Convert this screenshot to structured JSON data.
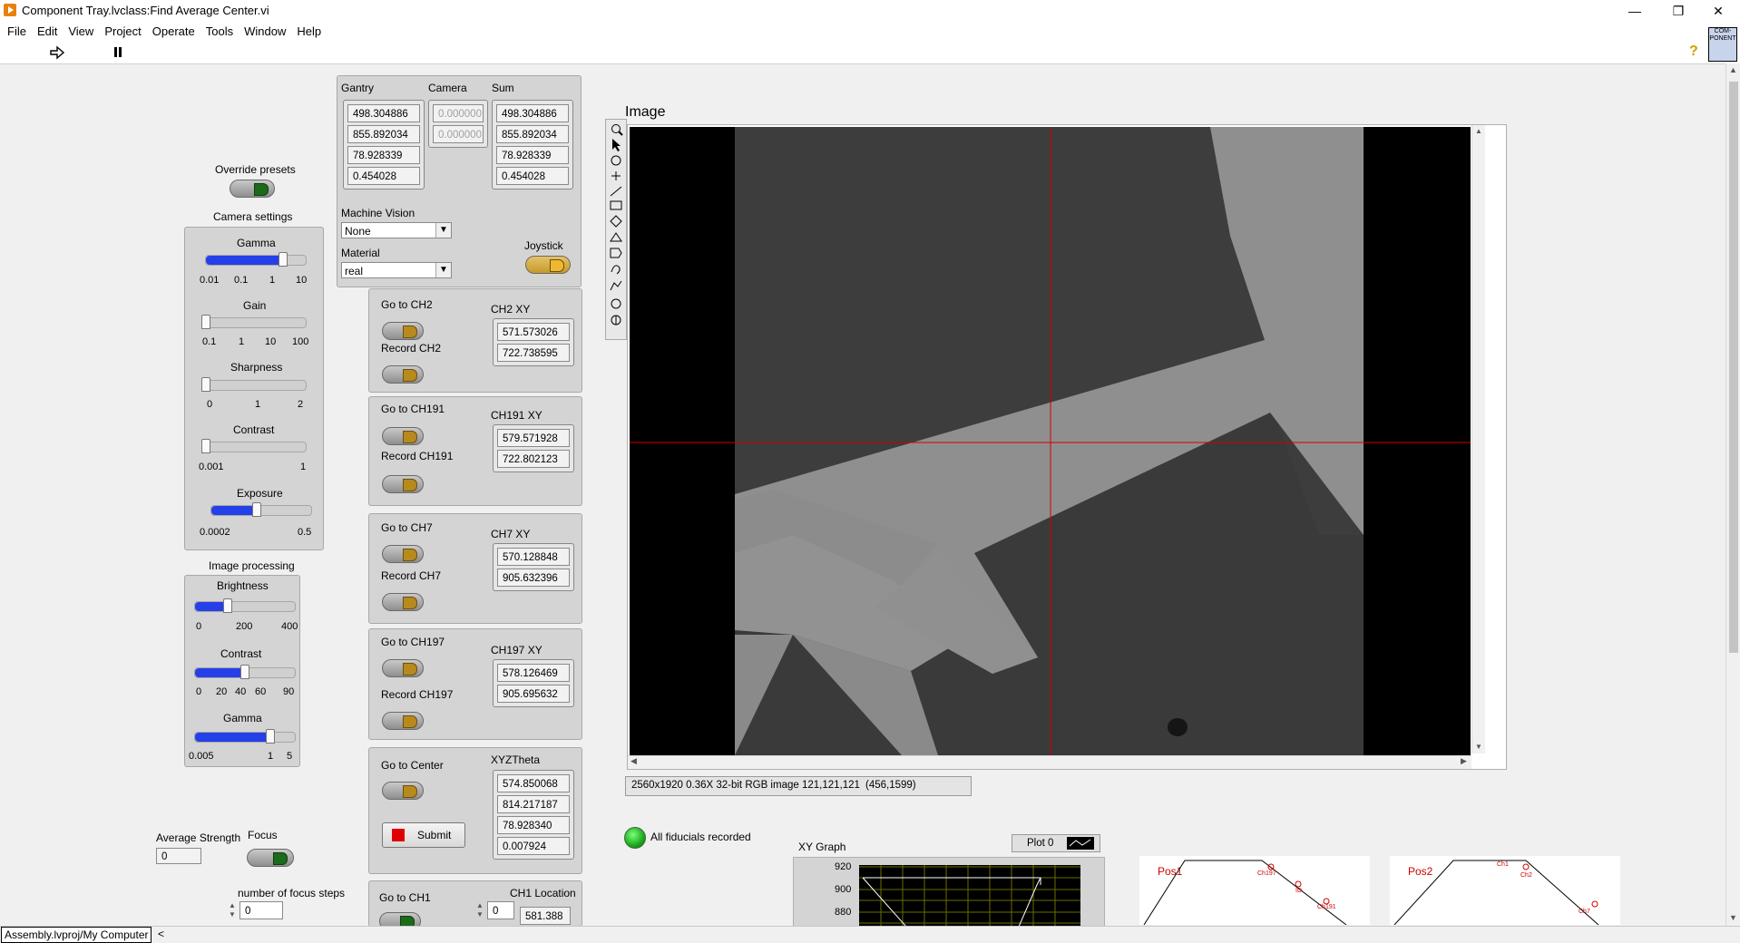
{
  "window": {
    "title": "Component Tray.lvclass:Find Average Center.vi",
    "minimize": "—",
    "restore": "❐",
    "close": "✕"
  },
  "menu": [
    "File",
    "Edit",
    "View",
    "Project",
    "Operate",
    "Tools",
    "Window",
    "Help"
  ],
  "toolbar": {
    "run_icon": "run-arrow-icon",
    "pause_icon": "pause-icon",
    "help": "?",
    "vi_icon_text": "COM-PONENT"
  },
  "gantry": {
    "header_gantry": "Gantry",
    "header_camera": "Camera",
    "header_sum": "Sum",
    "gantry_values": [
      "498.304886",
      "855.892034",
      "78.928339",
      "0.454028"
    ],
    "camera_values": [
      "0.000000",
      "0.000000"
    ],
    "sum_values": [
      "498.304886",
      "855.892034",
      "78.928339",
      "0.454028"
    ],
    "machine_vision_label": "Machine Vision",
    "machine_vision_value": "None",
    "material_label": "Material",
    "material_value": "real",
    "joystick_label": "Joystick"
  },
  "override_presets": "Override presets",
  "camera_settings": {
    "title": "Camera settings",
    "gamma": {
      "label": "Gamma",
      "ticks": [
        "0.01",
        "0.1",
        "1",
        "10"
      ],
      "level": 0.77
    },
    "gain": {
      "label": "Gain",
      "ticks": [
        "0.1",
        "1",
        "10",
        "100"
      ],
      "level": 0.0
    },
    "sharpness": {
      "label": "Sharpness",
      "ticks": [
        "0",
        "1",
        "2"
      ],
      "level": 0.0
    },
    "contrast": {
      "label": "Contrast",
      "ticks": [
        "0.001",
        "1"
      ],
      "level": 0.0
    },
    "exposure": {
      "label": "Exposure",
      "ticks": [
        "0.0002",
        "0.5"
      ],
      "level": 0.45
    }
  },
  "image_processing": {
    "title": "Image processing",
    "brightness": {
      "label": "Brightness",
      "ticks": [
        "0",
        "200",
        "400"
      ],
      "level": 0.33
    },
    "contrast": {
      "label": "Contrast",
      "ticks": [
        "0",
        "20",
        "40",
        "60",
        "90"
      ],
      "level": 0.5
    },
    "gamma": {
      "label": "Gamma",
      "ticks": [
        "0.005",
        "1",
        "5"
      ],
      "level": 0.75
    }
  },
  "average_strength": {
    "label": "Average Strength",
    "value": "0"
  },
  "focus": {
    "label": "Focus"
  },
  "focus_steps": {
    "label": "number of focus steps",
    "value": "0"
  },
  "channels": [
    {
      "go": "Go to CH2",
      "record": "Record CH2",
      "xy_label": "CH2 XY",
      "x": "571.573026",
      "y": "722.738595"
    },
    {
      "go": "Go to CH191",
      "record": "Record CH191",
      "xy_label": "CH191 XY",
      "x": "579.571928",
      "y": "722.802123"
    },
    {
      "go": "Go to CH7",
      "record": "Record CH7",
      "xy_label": "CH7 XY",
      "x": "570.128848",
      "y": "905.632396"
    },
    {
      "go": "Go to CH197",
      "record": "Record CH197",
      "xy_label": "CH197 XY",
      "x": "578.126469",
      "y": "905.695632"
    }
  ],
  "center": {
    "go": "Go to Center",
    "xyz_label": "XYZTheta",
    "values": [
      "574.850068",
      "814.217187",
      "78.928340",
      "0.007924"
    ],
    "submit": "Submit"
  },
  "ch1": {
    "go": "Go to CH1",
    "location_label": "CH1 Location",
    "index": "0",
    "value": "581.388"
  },
  "image": {
    "title": "Image",
    "status": "2560x1920 0.36X 32-bit RGB image 121,121,121",
    "coords": "(456,1599)"
  },
  "fiducials": {
    "label": "All fiducials recorded"
  },
  "xygraph": {
    "title": "XY Graph",
    "plot_label": "Plot 0",
    "yticks": [
      "920",
      "900",
      "880"
    ]
  },
  "pos1": {
    "title": "Pos1",
    "labels": [
      "Ch197",
      "ID",
      "Ch191"
    ]
  },
  "pos2": {
    "title": "Pos2",
    "labels": [
      "Ch1",
      "Ch2",
      "Ch7"
    ]
  },
  "statusbar": {
    "project": "Assembly.lvproj/My Computer",
    "arrow": "<"
  },
  "colors": {
    "led_green": "#1c6b1c",
    "slider_blue": "#2540e8",
    "crosshair": "#d00000",
    "submit_red": "#e00000"
  }
}
